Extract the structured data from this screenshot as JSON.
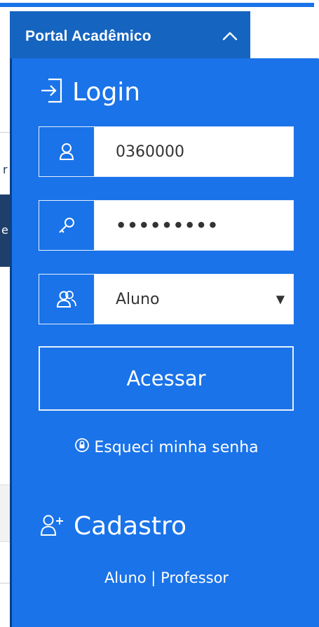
{
  "header": {
    "portal_title": "Portal Acadêmico",
    "toggle_icon": "chevron-up-icon"
  },
  "login": {
    "title": "Login",
    "title_icon": "login-icon",
    "username": {
      "icon": "user-icon",
      "value": "0360000"
    },
    "password": {
      "icon": "key-icon",
      "value": "•••••••••"
    },
    "profile": {
      "icon": "users-icon",
      "selected": "Aluno",
      "arrow": "▼"
    },
    "submit_label": "Acessar",
    "forgot": {
      "icon": "lock-reset-icon",
      "label": "Esqueci minha senha"
    }
  },
  "cadastro": {
    "title": "Cadastro",
    "title_icon": "user-add-icon",
    "links": {
      "aluno": "Aluno",
      "separator": "|",
      "professor": "Professor"
    }
  },
  "colors": {
    "panel_blue": "#1a73e8",
    "header_blue": "#1564c0",
    "text_white": "#ffffff"
  }
}
